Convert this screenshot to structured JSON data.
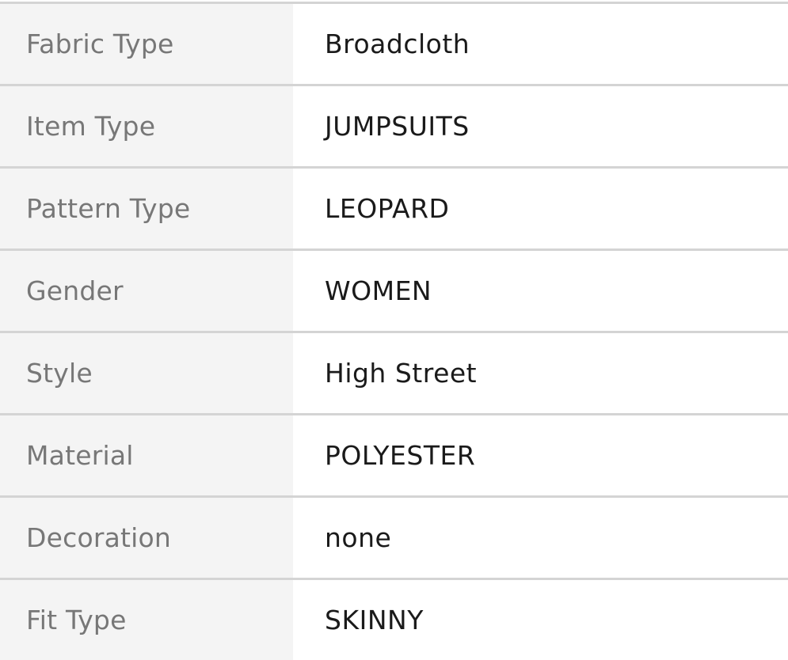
{
  "specifications": [
    {
      "label": "Fabric Type",
      "value": "Broadcloth"
    },
    {
      "label": "Item Type",
      "value": "JUMPSUITS"
    },
    {
      "label": "Pattern Type",
      "value": "LEOPARD"
    },
    {
      "label": "Gender",
      "value": "WOMEN"
    },
    {
      "label": "Style",
      "value": "High Street"
    },
    {
      "label": "Material",
      "value": "POLYESTER"
    },
    {
      "label": "Decoration",
      "value": "none"
    },
    {
      "label": "Fit Type",
      "value": "SKINNY"
    }
  ],
  "colors": {
    "label_bg": "#f4f4f4",
    "label_text": "#777777",
    "value_text": "#1a1a1a",
    "divider": "#d4d4d4"
  }
}
